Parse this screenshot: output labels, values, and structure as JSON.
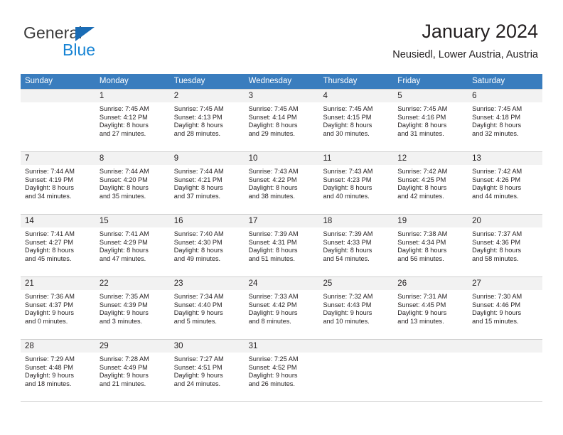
{
  "brand": {
    "name_part1": "General",
    "name_part2": "Blue",
    "accent_color": "#1583d4",
    "triangle_color": "#1a6cb5"
  },
  "header": {
    "title": "January 2024",
    "location": "Neusiedl, Lower Austria, Austria"
  },
  "calendar": {
    "header_color": "#3a7dbe",
    "weekdays": [
      "Sunday",
      "Monday",
      "Tuesday",
      "Wednesday",
      "Thursday",
      "Friday",
      "Saturday"
    ],
    "weeks": [
      [
        {
          "day": "",
          "sunrise": "",
          "sunset": "",
          "daylight1": "",
          "daylight2": ""
        },
        {
          "day": "1",
          "sunrise": "Sunrise: 7:45 AM",
          "sunset": "Sunset: 4:12 PM",
          "daylight1": "Daylight: 8 hours",
          "daylight2": "and 27 minutes."
        },
        {
          "day": "2",
          "sunrise": "Sunrise: 7:45 AM",
          "sunset": "Sunset: 4:13 PM",
          "daylight1": "Daylight: 8 hours",
          "daylight2": "and 28 minutes."
        },
        {
          "day": "3",
          "sunrise": "Sunrise: 7:45 AM",
          "sunset": "Sunset: 4:14 PM",
          "daylight1": "Daylight: 8 hours",
          "daylight2": "and 29 minutes."
        },
        {
          "day": "4",
          "sunrise": "Sunrise: 7:45 AM",
          "sunset": "Sunset: 4:15 PM",
          "daylight1": "Daylight: 8 hours",
          "daylight2": "and 30 minutes."
        },
        {
          "day": "5",
          "sunrise": "Sunrise: 7:45 AM",
          "sunset": "Sunset: 4:16 PM",
          "daylight1": "Daylight: 8 hours",
          "daylight2": "and 31 minutes."
        },
        {
          "day": "6",
          "sunrise": "Sunrise: 7:45 AM",
          "sunset": "Sunset: 4:18 PM",
          "daylight1": "Daylight: 8 hours",
          "daylight2": "and 32 minutes."
        }
      ],
      [
        {
          "day": "7",
          "sunrise": "Sunrise: 7:44 AM",
          "sunset": "Sunset: 4:19 PM",
          "daylight1": "Daylight: 8 hours",
          "daylight2": "and 34 minutes."
        },
        {
          "day": "8",
          "sunrise": "Sunrise: 7:44 AM",
          "sunset": "Sunset: 4:20 PM",
          "daylight1": "Daylight: 8 hours",
          "daylight2": "and 35 minutes."
        },
        {
          "day": "9",
          "sunrise": "Sunrise: 7:44 AM",
          "sunset": "Sunset: 4:21 PM",
          "daylight1": "Daylight: 8 hours",
          "daylight2": "and 37 minutes."
        },
        {
          "day": "10",
          "sunrise": "Sunrise: 7:43 AM",
          "sunset": "Sunset: 4:22 PM",
          "daylight1": "Daylight: 8 hours",
          "daylight2": "and 38 minutes."
        },
        {
          "day": "11",
          "sunrise": "Sunrise: 7:43 AM",
          "sunset": "Sunset: 4:23 PM",
          "daylight1": "Daylight: 8 hours",
          "daylight2": "and 40 minutes."
        },
        {
          "day": "12",
          "sunrise": "Sunrise: 7:42 AM",
          "sunset": "Sunset: 4:25 PM",
          "daylight1": "Daylight: 8 hours",
          "daylight2": "and 42 minutes."
        },
        {
          "day": "13",
          "sunrise": "Sunrise: 7:42 AM",
          "sunset": "Sunset: 4:26 PM",
          "daylight1": "Daylight: 8 hours",
          "daylight2": "and 44 minutes."
        }
      ],
      [
        {
          "day": "14",
          "sunrise": "Sunrise: 7:41 AM",
          "sunset": "Sunset: 4:27 PM",
          "daylight1": "Daylight: 8 hours",
          "daylight2": "and 45 minutes."
        },
        {
          "day": "15",
          "sunrise": "Sunrise: 7:41 AM",
          "sunset": "Sunset: 4:29 PM",
          "daylight1": "Daylight: 8 hours",
          "daylight2": "and 47 minutes."
        },
        {
          "day": "16",
          "sunrise": "Sunrise: 7:40 AM",
          "sunset": "Sunset: 4:30 PM",
          "daylight1": "Daylight: 8 hours",
          "daylight2": "and 49 minutes."
        },
        {
          "day": "17",
          "sunrise": "Sunrise: 7:39 AM",
          "sunset": "Sunset: 4:31 PM",
          "daylight1": "Daylight: 8 hours",
          "daylight2": "and 51 minutes."
        },
        {
          "day": "18",
          "sunrise": "Sunrise: 7:39 AM",
          "sunset": "Sunset: 4:33 PM",
          "daylight1": "Daylight: 8 hours",
          "daylight2": "and 54 minutes."
        },
        {
          "day": "19",
          "sunrise": "Sunrise: 7:38 AM",
          "sunset": "Sunset: 4:34 PM",
          "daylight1": "Daylight: 8 hours",
          "daylight2": "and 56 minutes."
        },
        {
          "day": "20",
          "sunrise": "Sunrise: 7:37 AM",
          "sunset": "Sunset: 4:36 PM",
          "daylight1": "Daylight: 8 hours",
          "daylight2": "and 58 minutes."
        }
      ],
      [
        {
          "day": "21",
          "sunrise": "Sunrise: 7:36 AM",
          "sunset": "Sunset: 4:37 PM",
          "daylight1": "Daylight: 9 hours",
          "daylight2": "and 0 minutes."
        },
        {
          "day": "22",
          "sunrise": "Sunrise: 7:35 AM",
          "sunset": "Sunset: 4:39 PM",
          "daylight1": "Daylight: 9 hours",
          "daylight2": "and 3 minutes."
        },
        {
          "day": "23",
          "sunrise": "Sunrise: 7:34 AM",
          "sunset": "Sunset: 4:40 PM",
          "daylight1": "Daylight: 9 hours",
          "daylight2": "and 5 minutes."
        },
        {
          "day": "24",
          "sunrise": "Sunrise: 7:33 AM",
          "sunset": "Sunset: 4:42 PM",
          "daylight1": "Daylight: 9 hours",
          "daylight2": "and 8 minutes."
        },
        {
          "day": "25",
          "sunrise": "Sunrise: 7:32 AM",
          "sunset": "Sunset: 4:43 PM",
          "daylight1": "Daylight: 9 hours",
          "daylight2": "and 10 minutes."
        },
        {
          "day": "26",
          "sunrise": "Sunrise: 7:31 AM",
          "sunset": "Sunset: 4:45 PM",
          "daylight1": "Daylight: 9 hours",
          "daylight2": "and 13 minutes."
        },
        {
          "day": "27",
          "sunrise": "Sunrise: 7:30 AM",
          "sunset": "Sunset: 4:46 PM",
          "daylight1": "Daylight: 9 hours",
          "daylight2": "and 15 minutes."
        }
      ],
      [
        {
          "day": "28",
          "sunrise": "Sunrise: 7:29 AM",
          "sunset": "Sunset: 4:48 PM",
          "daylight1": "Daylight: 9 hours",
          "daylight2": "and 18 minutes."
        },
        {
          "day": "29",
          "sunrise": "Sunrise: 7:28 AM",
          "sunset": "Sunset: 4:49 PM",
          "daylight1": "Daylight: 9 hours",
          "daylight2": "and 21 minutes."
        },
        {
          "day": "30",
          "sunrise": "Sunrise: 7:27 AM",
          "sunset": "Sunset: 4:51 PM",
          "daylight1": "Daylight: 9 hours",
          "daylight2": "and 24 minutes."
        },
        {
          "day": "31",
          "sunrise": "Sunrise: 7:25 AM",
          "sunset": "Sunset: 4:52 PM",
          "daylight1": "Daylight: 9 hours",
          "daylight2": "and 26 minutes."
        },
        {
          "day": "",
          "sunrise": "",
          "sunset": "",
          "daylight1": "",
          "daylight2": ""
        },
        {
          "day": "",
          "sunrise": "",
          "sunset": "",
          "daylight1": "",
          "daylight2": ""
        },
        {
          "day": "",
          "sunrise": "",
          "sunset": "",
          "daylight1": "",
          "daylight2": ""
        }
      ]
    ]
  }
}
